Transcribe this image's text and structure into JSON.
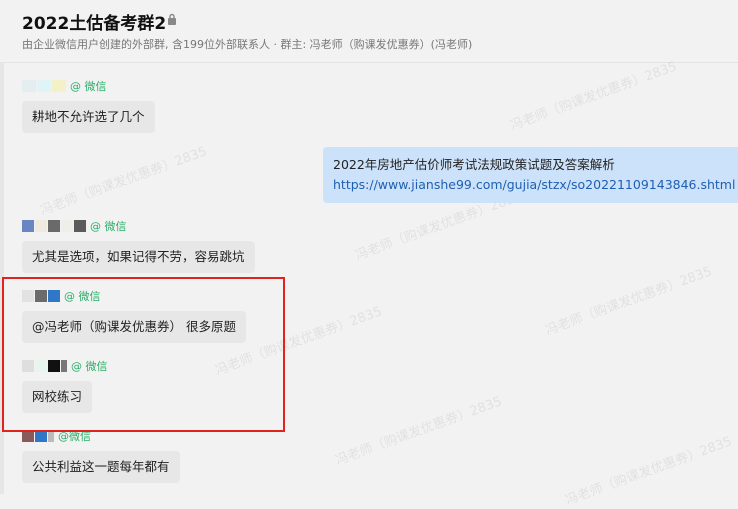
{
  "header": {
    "title": "2022土估备考群2",
    "subtitle": "由企业微信用户创建的外部群, 含199位外部联系人 · 群主: 冯老师（购课发优惠券）(冯老师)"
  },
  "watermark_text": "冯老师（购课发优惠券）2835",
  "wechat_tag": "@ 微信",
  "messages": [
    {
      "side": "left",
      "text": "耕地不允许选了几个",
      "sender_tag": "@ 微信"
    },
    {
      "side": "right",
      "lines": [
        "2022年房地产估价师考试法规政策试题及答案解析",
        "https://www.jianshe99.com/gujia/stzx/so20221109143846.shtml"
      ]
    },
    {
      "side": "left",
      "text": "尤其是选项，如果记得不劳，容易跳坑",
      "sender_tag": "@ 微信"
    },
    {
      "side": "left",
      "text": "@冯老师（购课发优惠券） 很多原题",
      "sender_tag": "@ 微信"
    },
    {
      "side": "left",
      "text": "网校练习",
      "sender_tag": "@ 微信"
    },
    {
      "side": "left",
      "text": "公共利益这一题每年都有",
      "sender_tag": "@微信"
    }
  ],
  "colors": {
    "highlight_border": "#e0231f",
    "wechat_green": "#2aae67",
    "link_blue": "#1f5fb2",
    "own_bubble": "#cce2fa"
  }
}
